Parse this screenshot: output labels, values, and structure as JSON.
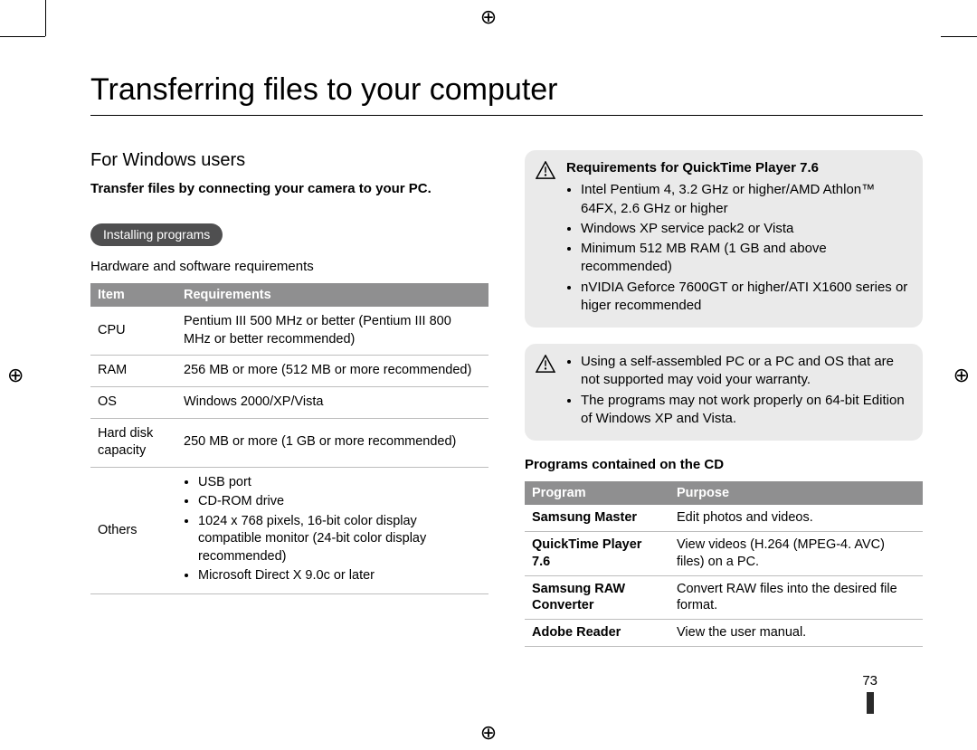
{
  "page_number": "73",
  "title": "Transferring files to your computer",
  "left": {
    "section_title": "For Windows users",
    "lead": "Transfer files by connecting your camera to your PC.",
    "pill": "Installing programs",
    "hw_heading": "Hardware and software requirements",
    "req_table": {
      "headers": {
        "item": "Item",
        "req": "Requirements"
      },
      "rows": [
        {
          "item": "CPU",
          "req": "Pentium III 500 MHz or better (Pentium III 800 MHz or better recommended)"
        },
        {
          "item": "RAM",
          "req": "256 MB or more (512 MB or more recommended)"
        },
        {
          "item": "OS",
          "req": "Windows 2000/XP/Vista"
        },
        {
          "item": "Hard disk capacity",
          "req": "250 MB or more (1 GB or more recommended)"
        }
      ],
      "others_label": "Others",
      "others_bullets": [
        "USB port",
        "CD-ROM drive",
        "1024 x 768 pixels, 16-bit color display compatible monitor (24-bit color display recommended)",
        "Microsoft Direct X 9.0c or later"
      ]
    }
  },
  "right": {
    "note1_title": "Requirements for QuickTime Player 7.6",
    "note1_bullets": [
      "Intel Pentium 4, 3.2 GHz or higher/AMD Athlon™ 64FX, 2.6 GHz or higher",
      "Windows XP service pack2 or Vista",
      "Minimum 512 MB RAM (1 GB and above recommended)",
      "nVIDIA Geforce 7600GT or higher/ATI X1600 series or higer recommended"
    ],
    "note2_bullets": [
      "Using a self-assembled PC or a PC and OS that are not supported may void your warranty.",
      "The programs may not work properly on 64-bit Edition of Windows XP and Vista."
    ],
    "programs_heading": "Programs contained on the CD",
    "prog_table": {
      "headers": {
        "program": "Program",
        "purpose": "Purpose"
      },
      "rows": [
        {
          "program": "Samsung Master",
          "purpose": "Edit photos and videos."
        },
        {
          "program": "QuickTime Player 7.6",
          "purpose": "View videos (H.264 (MPEG-4. AVC) files) on a PC."
        },
        {
          "program": "Samsung RAW Converter",
          "purpose": "Convert RAW files into the desired file format."
        },
        {
          "program": "Adobe Reader",
          "purpose": "View the user manual."
        }
      ]
    }
  }
}
